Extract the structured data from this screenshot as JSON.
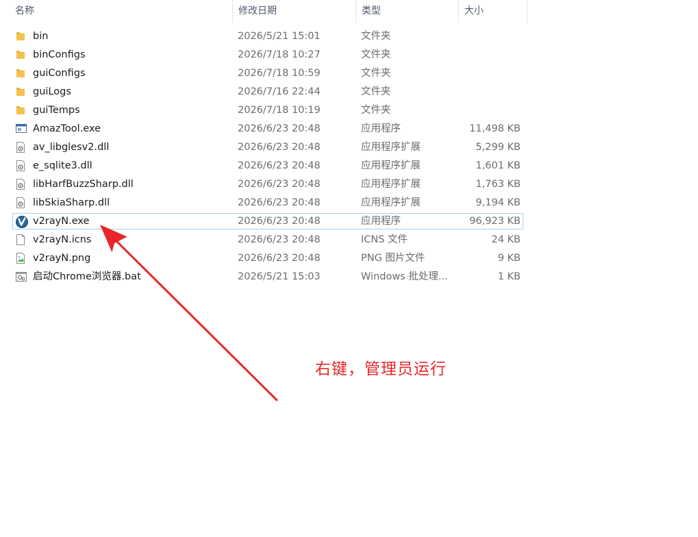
{
  "header": {
    "name": "名称",
    "date": "修改日期",
    "type": "类型",
    "size": "大小"
  },
  "files": [
    {
      "name": "bin",
      "date": "2026/5/21 15:01",
      "type": "文件夹",
      "size": "",
      "icon": "folder-icon"
    },
    {
      "name": "binConfigs",
      "date": "2026/7/18 10:27",
      "type": "文件夹",
      "size": "",
      "icon": "folder-icon"
    },
    {
      "name": "guiConfigs",
      "date": "2026/7/18 10:59",
      "type": "文件夹",
      "size": "",
      "icon": "folder-icon"
    },
    {
      "name": "guiLogs",
      "date": "2026/7/16 22:44",
      "type": "文件夹",
      "size": "",
      "icon": "folder-icon"
    },
    {
      "name": "guiTemps",
      "date": "2026/7/18 10:19",
      "type": "文件夹",
      "size": "",
      "icon": "folder-icon"
    },
    {
      "name": "AmazTool.exe",
      "date": "2026/6/23 20:48",
      "type": "应用程序",
      "size": "11,498 KB",
      "icon": "exe-window-icon"
    },
    {
      "name": "av_libglesv2.dll",
      "date": "2026/6/23 20:48",
      "type": "应用程序扩展",
      "size": "5,299 KB",
      "icon": "dll-gear-icon"
    },
    {
      "name": "e_sqlite3.dll",
      "date": "2026/6/23 20:48",
      "type": "应用程序扩展",
      "size": "1,601 KB",
      "icon": "dll-gear-icon"
    },
    {
      "name": "libHarfBuzzSharp.dll",
      "date": "2026/6/23 20:48",
      "type": "应用程序扩展",
      "size": "1,763 KB",
      "icon": "dll-gear-icon"
    },
    {
      "name": "libSkiaSharp.dll",
      "date": "2026/6/23 20:48",
      "type": "应用程序扩展",
      "size": "9,194 KB",
      "icon": "dll-gear-icon"
    },
    {
      "name": "v2rayN.exe",
      "date": "2026/6/23 20:48",
      "type": "应用程序",
      "size": "96,923 KB",
      "icon": "v2rayn-app-icon",
      "selected": true
    },
    {
      "name": "v2rayN.icns",
      "date": "2026/6/23 20:48",
      "type": "ICNS 文件",
      "size": "24 KB",
      "icon": "blank-file-icon"
    },
    {
      "name": "v2rayN.png",
      "date": "2026/6/23 20:48",
      "type": "PNG 图片文件",
      "size": "9 KB",
      "icon": "image-file-icon"
    },
    {
      "name": "启动Chrome浏览器.bat",
      "date": "2026/5/21 15:03",
      "type": "Windows 批处理...",
      "size": "1 KB",
      "icon": "bat-gear-icon"
    }
  ],
  "annotation": {
    "text": "右键，管理员运行",
    "color": "#e8262a"
  },
  "colors": {
    "folder": "#f4c34f",
    "selection_border": "#a7cfee",
    "header_text": "#4d5a6b"
  }
}
